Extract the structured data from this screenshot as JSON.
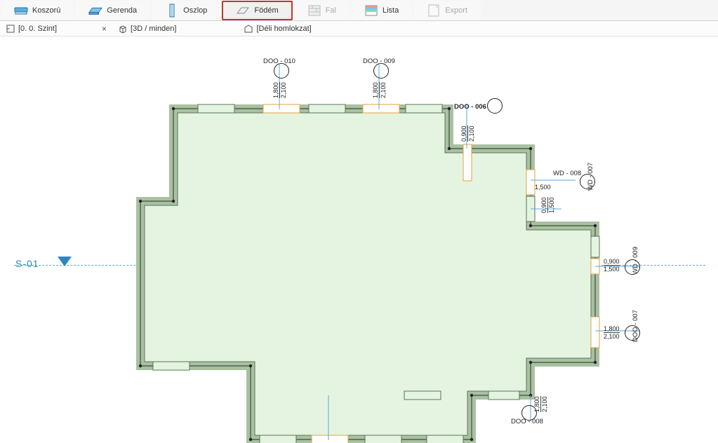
{
  "toolbar": {
    "koszoru": "Koszorú",
    "gerenda": "Gerenda",
    "oszlop": "Oszlop",
    "fodem": "Födém",
    "fal": "Fal",
    "lista": "Lista",
    "export": "Export"
  },
  "tabs": {
    "tab1": "[0. 0. Szint]",
    "tab2": "[3D / minden]",
    "tab3": "[Déli homlokzat]"
  },
  "section": {
    "label": "S-01"
  },
  "tags": {
    "doo010": "DOO - 010",
    "doo009": "DOO - 009",
    "doo006": "DOO - 006",
    "wd008": "WD - 008",
    "wd007": "WD - 007",
    "wd009": "WD - 009",
    "doo007": "DOO - 007",
    "doo008": "DOO - 008"
  },
  "dims": {
    "d1800": "1,800",
    "d2100": "2,100",
    "d0900": "0,900",
    "d1500": "1,500"
  }
}
